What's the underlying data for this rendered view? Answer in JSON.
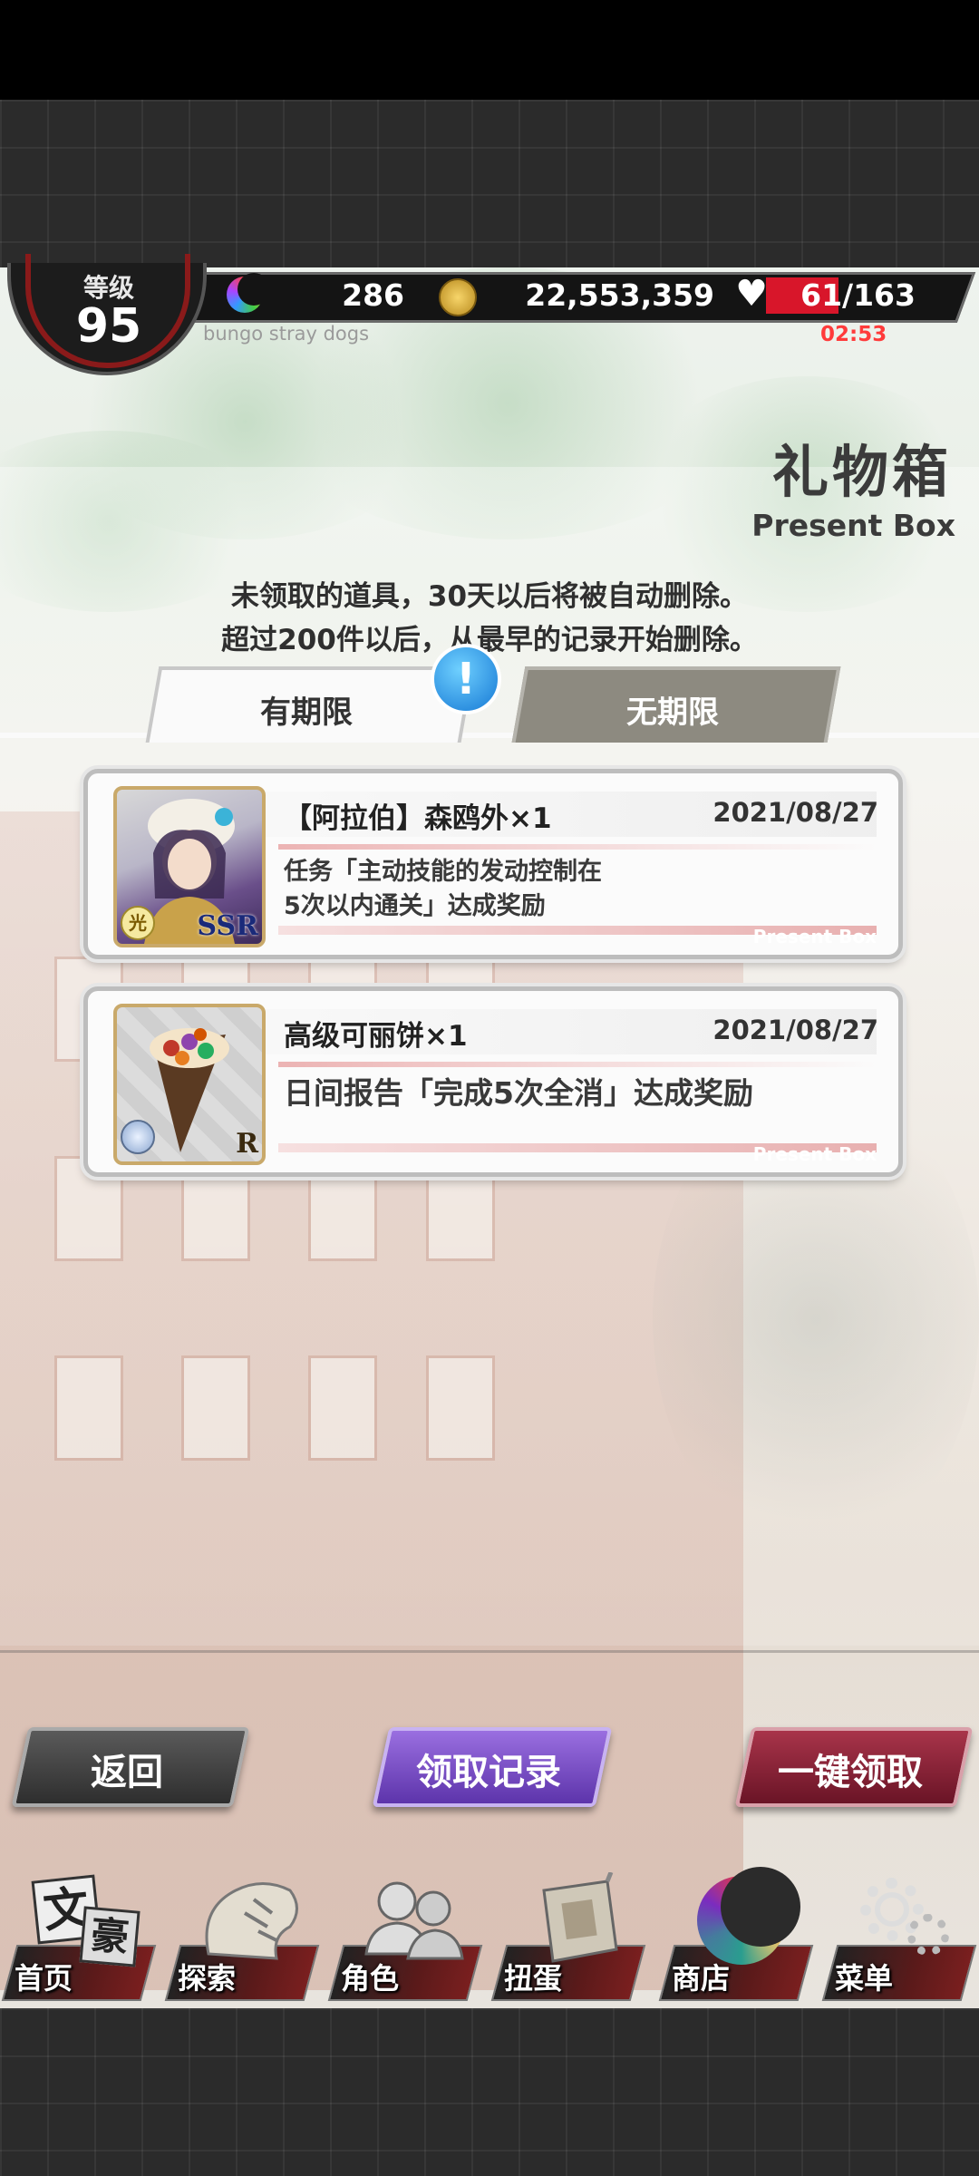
{
  "status": {
    "level_label": "等级",
    "level_value": "95",
    "moonstones": "286",
    "coins": "22,553,359",
    "stamina": "61/163",
    "timer": "02:53",
    "subtitle": "bungo stray dogs"
  },
  "header": {
    "title_cn": "礼物箱",
    "title_en": "Present Box",
    "notice_line1": "未领取的道具，30天以后将被自动删除。",
    "notice_line2": "超过200件以后，从最早的记录开始删除。"
  },
  "tabs": [
    {
      "label": "有期限",
      "active": true
    },
    {
      "label": "无期限",
      "active": false
    }
  ],
  "alert_mark": "!",
  "items": [
    {
      "name": "【阿拉伯】森鸥外×1",
      "date": "2021/08/27",
      "desc_line1": "任务「主动技能的发动控制在",
      "desc_line2": "5次以内通关」达成奖励",
      "tag": "Present Box",
      "rarity": "SSR",
      "element": "光"
    },
    {
      "name": "高级可丽饼×1",
      "date": "2021/08/27",
      "desc_line1": "日间报告「完成5次全消」达成奖励",
      "tag": "Present Box",
      "rarity": "R"
    }
  ],
  "buttons": {
    "back": "返回",
    "log": "领取记录",
    "claim_all": "一键领取"
  },
  "nav": [
    {
      "label": "首页",
      "icon": "home-icon"
    },
    {
      "label": "探索",
      "icon": "tiger-icon"
    },
    {
      "label": "角色",
      "icon": "characters-icon"
    },
    {
      "label": "扭蛋",
      "icon": "book-icon"
    },
    {
      "label": "商店",
      "icon": "moon-icon"
    },
    {
      "label": "菜单",
      "icon": "gear-icon"
    }
  ],
  "home_icon_text": {
    "a": "文",
    "b": "豪"
  },
  "colors": {
    "stamina_red": "#d8162a",
    "timer_red": "#ff3b3b",
    "log_purple": "#5d34ab",
    "claim_red": "#6a1426"
  }
}
